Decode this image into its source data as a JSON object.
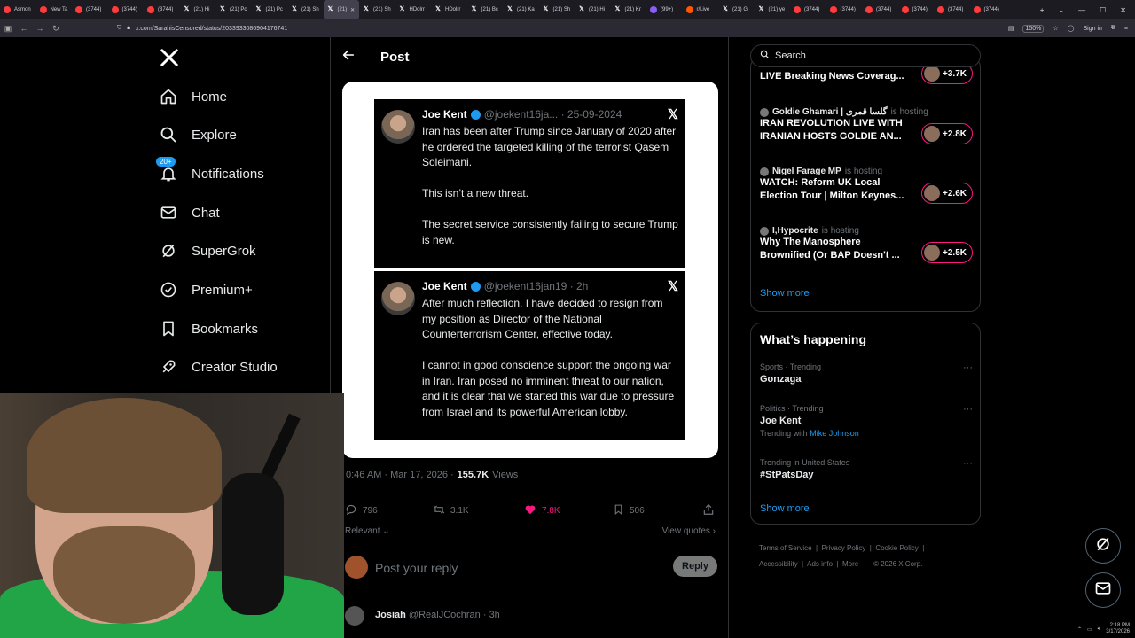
{
  "browser": {
    "tabs": [
      {
        "label": "Asmon",
        "icon": "red"
      },
      {
        "label": "New Ta",
        "icon": "red"
      },
      {
        "label": "(3744)",
        "icon": "red"
      },
      {
        "label": "(3744)",
        "icon": "red"
      },
      {
        "label": "(3744)",
        "icon": "red"
      },
      {
        "label": "(21) Hi",
        "icon": "x"
      },
      {
        "label": "(21) Pc",
        "icon": "x"
      },
      {
        "label": "(21) Pc",
        "icon": "x"
      },
      {
        "label": "(21) Sh",
        "icon": "x"
      },
      {
        "label": "(21) ",
        "icon": "x",
        "active": true
      },
      {
        "label": "(21) Sh",
        "icon": "x"
      },
      {
        "label": "HDolrr",
        "icon": "x"
      },
      {
        "label": "HDolrr",
        "icon": "x"
      },
      {
        "label": "(21) Bc",
        "icon": "x"
      },
      {
        "label": "(21) Ka",
        "icon": "x"
      },
      {
        "label": "(21) Sh",
        "icon": "x"
      },
      {
        "label": "(21) Hi",
        "icon": "x"
      },
      {
        "label": "(21) Kr",
        "icon": "x"
      },
      {
        "label": "(99+) ",
        "icon": "purple"
      },
      {
        "label": "r/Live",
        "icon": "orange"
      },
      {
        "label": "(21) Gi",
        "icon": "x"
      },
      {
        "label": "(21) ye",
        "icon": "x"
      },
      {
        "label": "(3744)",
        "icon": "red"
      },
      {
        "label": "(3744)",
        "icon": "red"
      },
      {
        "label": "(3744)",
        "icon": "red"
      },
      {
        "label": "(3744)",
        "icon": "red"
      },
      {
        "label": "(3744)",
        "icon": "red"
      },
      {
        "label": "(3744)",
        "icon": "red"
      }
    ],
    "url": "x.com/SarahisCensored/status/2033933086904176741",
    "zoom": "150%",
    "sign_in": "Sign in"
  },
  "nav": {
    "items": [
      {
        "label": "Home",
        "icon": "home-icon"
      },
      {
        "label": "Explore",
        "icon": "search-icon"
      },
      {
        "label": "Notifications",
        "icon": "bell-icon",
        "badge": "20+"
      },
      {
        "label": "Chat",
        "icon": "mail-icon"
      },
      {
        "label": "SuperGrok",
        "icon": "grok-icon"
      },
      {
        "label": "Premium+",
        "icon": "verified-icon"
      },
      {
        "label": "Bookmarks",
        "icon": "bookmark-icon"
      },
      {
        "label": "Creator Studio",
        "icon": "rocket-icon"
      }
    ]
  },
  "post": {
    "header_title": "Post",
    "tweet1": {
      "name": "Joe Kent",
      "meta": "@joekent16ja... · 25-09-2024",
      "text": "Iran has been after Trump since January of 2020 after he ordered the targeted killing of the terrorist Qasem Soleimani.\n\nThis isn’t a new threat.\n\nThe secret service consistently failing to secure Trump is new."
    },
    "tweet2": {
      "name": "Joe Kent",
      "meta": "@joekent16jan19 · 2h",
      "text": "After much reflection, I have decided to resign from my position as Director of the National Counterterrorism Center, effective today.\n\nI cannot in good conscience support the ongoing war in Iran. Iran posed no imminent threat to our nation, and it is clear that we started this war due to pressure from Israel and its powerful American lobby."
    },
    "time": "0:46 AM · Mar 17, 2026 ·",
    "views_count": "155.7K",
    "views_label": "Views",
    "replies": "796",
    "reposts": "3.1K",
    "likes": "7.8K",
    "bookmarks": "506",
    "sort_label": "Relevant",
    "view_quotes": "View quotes",
    "reply_placeholder": "Post your reply",
    "reply_button": "Reply",
    "next_reply_name": "Josiah",
    "next_reply_handle": "@RealJCochran · 3h"
  },
  "right": {
    "search_placeholder": "Search",
    "live": [
      {
        "host": "",
        "hosting": "",
        "title": "LIVE Breaking News Coverag...",
        "count": "+3.7K"
      },
      {
        "host": "Goldie Ghamari | گلسا قمری",
        "hosting": "is hosting",
        "title": "IRAN REVOLUTION LIVE WITH IRANIAN HOSTS GOLDIE AN...",
        "count": "+2.8K"
      },
      {
        "host": "Nigel Farage MP",
        "hosting": "is hosting",
        "title": "WATCH: Reform UK Local Election Tour | Milton Keynes...",
        "count": "+2.6K"
      },
      {
        "host": "I,Hypocrite",
        "hosting": "is hosting",
        "title": "Why The Manosphere Brownified (Or BAP Doesn't ...",
        "count": "+2.5K"
      }
    ],
    "show_more_1": "Show more",
    "happening_title": "What’s happening",
    "trends": [
      {
        "category": "Sports · Trending",
        "name": "Gonzaga",
        "with_label": "",
        "with_link": ""
      },
      {
        "category": "Politics · Trending",
        "name": "Joe Kent",
        "with_label": "Trending with",
        "with_link": "Mike Johnson"
      },
      {
        "category": "Trending in United States",
        "name": "#StPatsDay",
        "with_label": "",
        "with_link": ""
      }
    ],
    "show_more_2": "Show more",
    "footer": {
      "terms": "Terms of Service",
      "privacy": "Privacy Policy",
      "cookie": "Cookie Policy",
      "accessibility": "Accessibility",
      "ads": "Ads info",
      "more": "More ···",
      "copyright": "© 2026 X Corp."
    }
  },
  "taskbar": {
    "time": "2:18 PM",
    "date": "3/17/2026"
  }
}
